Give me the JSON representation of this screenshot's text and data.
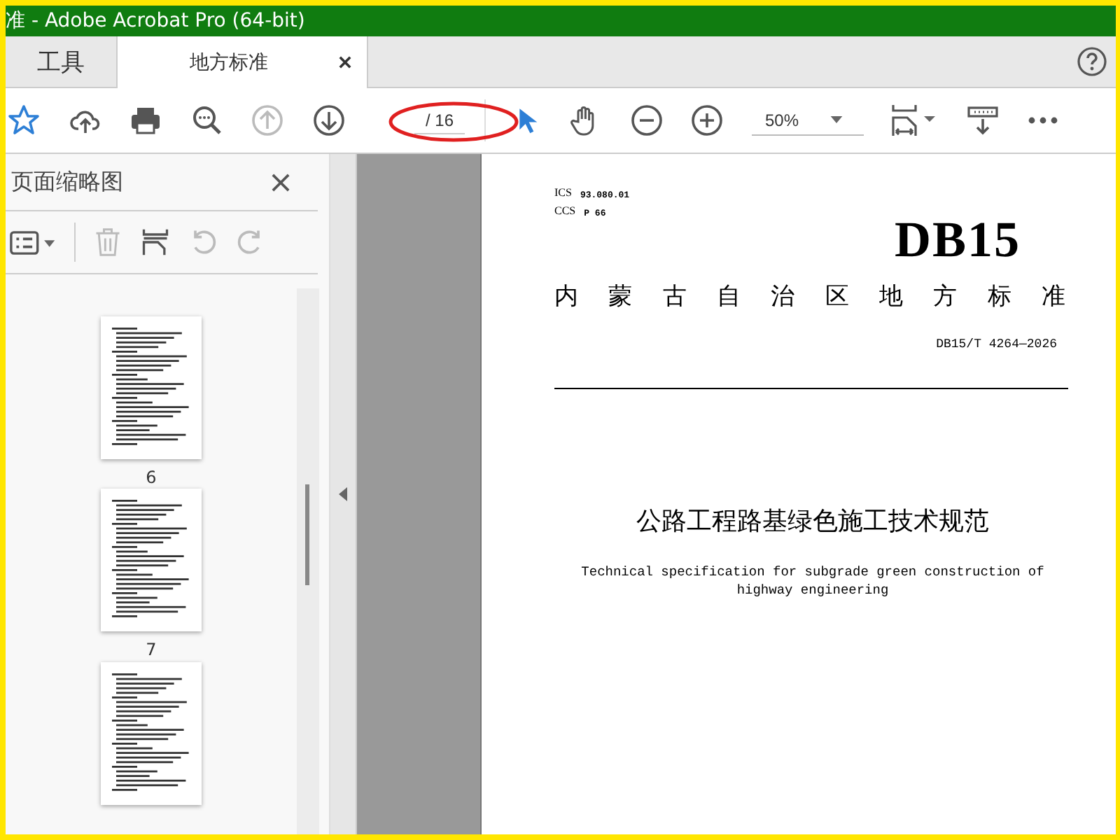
{
  "window": {
    "title": "准 - Adobe Acrobat Pro (64-bit)"
  },
  "tabs": [
    {
      "label": "工具",
      "kind": "home",
      "selected": false
    },
    {
      "label": "地方标准",
      "kind": "document",
      "selected": true
    }
  ],
  "toolbar": {
    "page_field": {
      "value": "/ 16"
    },
    "zoom_field": {
      "value": "50%"
    }
  },
  "sidebar": {
    "title": "页面缩略图",
    "thumbnails": [
      {
        "kind": "labeled",
        "label": "6"
      },
      {
        "kind": "labeled",
        "label": "7"
      },
      {
        "kind": "cut"
      }
    ]
  },
  "document": {
    "ics": {
      "label": "ICS",
      "value": "93.080.01"
    },
    "ccs": {
      "label": "CCS",
      "value": "P 66"
    },
    "logo": "DB15",
    "issuer": "内蒙古自治区地方标准",
    "code": "DB15/T 4264—2026",
    "title": "公路工程路基绿色施工技术规范",
    "subtitle": "Technical specification for subgrade green construction of highway engineering"
  }
}
